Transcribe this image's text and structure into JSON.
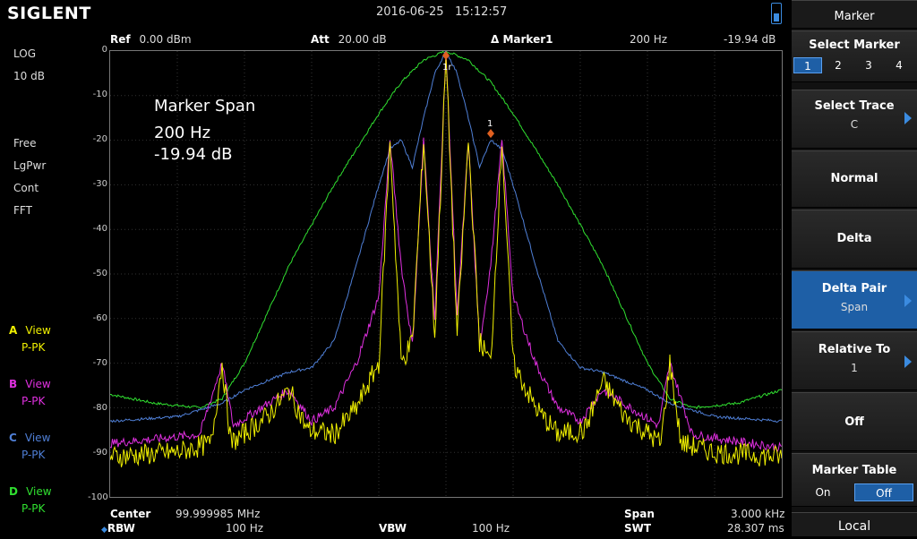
{
  "brand": "SIGLENT",
  "datetime": "2016-06-25   15:12:57",
  "left_status": [
    "LOG",
    "10 dB",
    "Free",
    "LgPwr",
    "Cont",
    "FFT"
  ],
  "traces": [
    {
      "letter": "A",
      "mode": "View",
      "det": "P-PK",
      "color": "#f0f000"
    },
    {
      "letter": "B",
      "mode": "View",
      "det": "P-PK",
      "color": "#e030e0"
    },
    {
      "letter": "C",
      "mode": "View",
      "det": "P-PK",
      "color": "#4f7fd6"
    },
    {
      "letter": "D",
      "mode": "View",
      "det": "P-PK",
      "color": "#30e030"
    }
  ],
  "header": {
    "ref_label": "Ref",
    "ref_value": "0.00 dBm",
    "att_label": "Att",
    "att_value": "20.00 dB",
    "marker_label": "Δ Marker1",
    "marker_freq": "200 Hz",
    "marker_amp": "-19.94 dB"
  },
  "annotation": {
    "title": "Marker Span",
    "freq": "200 Hz",
    "amp": "-19.94 dB"
  },
  "footer": {
    "center_label": "Center",
    "center_value": "99.999985 MHz",
    "span_label": "Span",
    "span_value": "3.000 kHz",
    "rbw_label": "RBW",
    "rbw_value": "100 Hz",
    "vbw_label": "VBW",
    "vbw_value": "100 Hz",
    "swt_label": "SWT",
    "swt_value": "28.307 ms"
  },
  "markers": {
    "m1r": "1r",
    "m1": "1"
  },
  "menu": {
    "title": "Marker",
    "select_marker": "Select Marker",
    "marker_numbers": [
      "1",
      "2",
      "3",
      "4"
    ],
    "select_trace": "Select Trace",
    "select_trace_value": "C",
    "normal": "Normal",
    "delta": "Delta",
    "delta_pair": "Delta Pair",
    "delta_pair_value": "Span",
    "relative_to": "Relative To",
    "relative_to_value": "1",
    "off": "Off",
    "marker_table": "Marker Table",
    "table_on": "On",
    "table_off": "Off",
    "local": "Local"
  },
  "chart_data": {
    "type": "line",
    "ylabel_ticks": [
      "0",
      "-10",
      "-20",
      "-30",
      "-40",
      "-50",
      "-60",
      "-70",
      "-80",
      "-90",
      "-100"
    ],
    "ylim": [
      -100,
      0
    ],
    "xlim": [
      -1500,
      1500
    ],
    "grid": true,
    "series": [
      {
        "trace": "D",
        "color": "#30e030",
        "x": [
          -1500,
          -1300,
          -1100,
          -1000,
          -900,
          -700,
          -500,
          -300,
          -200,
          -100,
          0,
          100,
          200,
          300,
          500,
          700,
          900,
          1000,
          1100,
          1300,
          1500
        ],
        "y": [
          -77,
          -79,
          -80,
          -78,
          -70,
          -48,
          -30,
          -14,
          -7,
          -2,
          0,
          -2,
          -7,
          -14,
          -30,
          -48,
          -70,
          -78,
          -80,
          -79,
          -76
        ]
      },
      {
        "trace": "C",
        "color": "#4f7fd6",
        "x": [
          -1500,
          -1200,
          -1000,
          -900,
          -700,
          -600,
          -500,
          -400,
          -300,
          -250,
          -200,
          -150,
          -100,
          -50,
          0,
          50,
          100,
          150,
          200,
          250,
          300,
          400,
          500,
          600,
          700,
          900,
          1000,
          1200,
          1500
        ],
        "y": [
          -83,
          -82,
          -79,
          -76,
          -72,
          -71,
          -65,
          -48,
          -30,
          -22,
          -20,
          -26,
          -15,
          -5,
          0,
          -5,
          -15,
          -26,
          -20,
          -22,
          -30,
          -48,
          -65,
          -71,
          -72,
          -76,
          -79,
          -82,
          -83
        ]
      },
      {
        "trace": "B",
        "color": "#e030e0",
        "x": [
          -1500,
          -1100,
          -1000,
          -950,
          -700,
          -600,
          -500,
          -400,
          -300,
          -250,
          -200,
          -150,
          -100,
          -50,
          0,
          50,
          100,
          150,
          200,
          250,
          300,
          400,
          500,
          600,
          700,
          950,
          1000,
          1100,
          1500
        ],
        "y": [
          -88,
          -86,
          -70,
          -84,
          -76,
          -83,
          -80,
          -70,
          -55,
          -20,
          -48,
          -66,
          -20,
          -60,
          0,
          -60,
          -20,
          -66,
          -48,
          -20,
          -55,
          -70,
          -80,
          -83,
          -76,
          -84,
          -70,
          -86,
          -89
        ]
      },
      {
        "trace": "A",
        "color": "#f0f000",
        "x": [
          -1500,
          -1200,
          -1050,
          -1000,
          -960,
          -800,
          -700,
          -620,
          -500,
          -400,
          -300,
          -250,
          -200,
          -150,
          -100,
          -50,
          0,
          50,
          100,
          150,
          200,
          250,
          300,
          400,
          500,
          620,
          700,
          800,
          960,
          1000,
          1050,
          1200,
          1500
        ],
        "y": [
          -91,
          -90,
          -88,
          -70,
          -88,
          -82,
          -76,
          -85,
          -86,
          -80,
          -70,
          -20,
          -70,
          -65,
          -20,
          -64,
          -1,
          -64,
          -20,
          -65,
          -70,
          -20,
          -70,
          -80,
          -86,
          -85,
          -74,
          -82,
          -88,
          -70,
          -88,
          -90,
          -91
        ]
      }
    ]
  }
}
